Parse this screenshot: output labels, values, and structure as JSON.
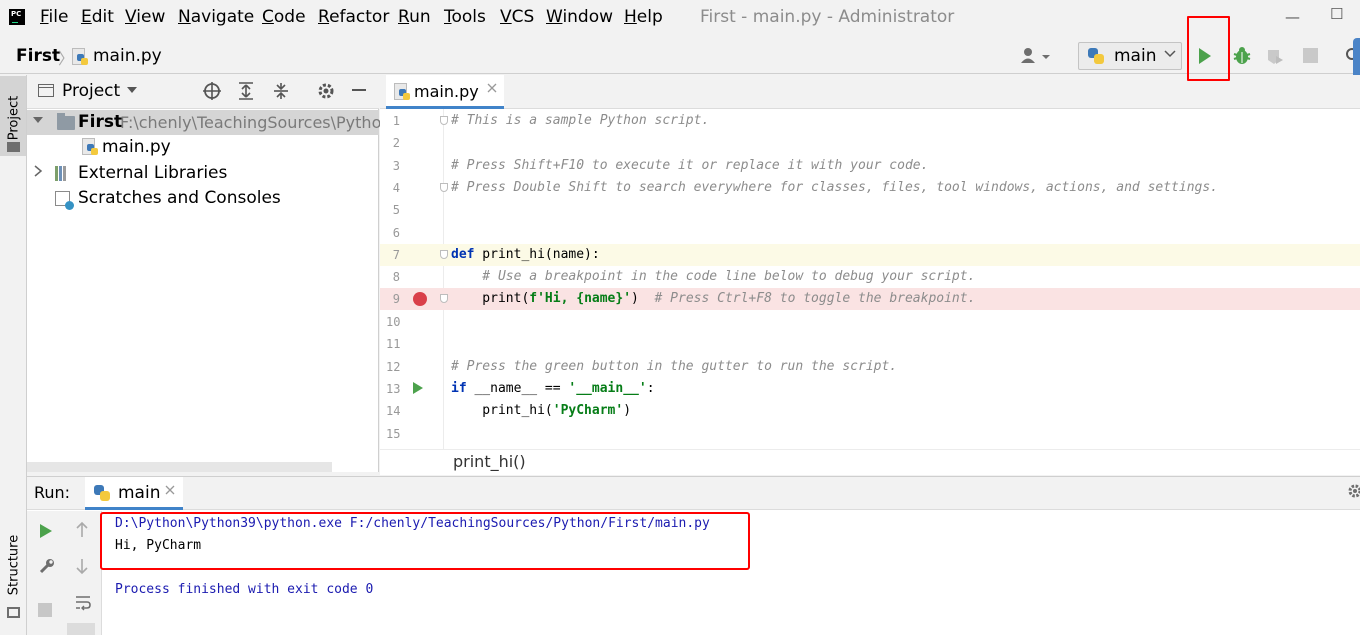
{
  "window": {
    "title": "First - main.py - Administrator",
    "minimize": "—",
    "maximize": "☐"
  },
  "menu": [
    "File",
    "Edit",
    "View",
    "Navigate",
    "Code",
    "Refactor",
    "Run",
    "Tools",
    "VCS",
    "Window",
    "Help"
  ],
  "navbar": {
    "project": "First",
    "separator": "〉",
    "file": "main.py",
    "run_config": "main",
    "user_icon": "user-icon"
  },
  "project_panel": {
    "tab_label": "Project",
    "header_label": "Project",
    "tree": [
      {
        "label": "First",
        "path": "F:\\chenly\\TeachingSources\\Pytho",
        "expanded": true,
        "icon": "folder-icon"
      },
      {
        "label": "main.py",
        "icon": "python-file-icon"
      },
      {
        "label": "External Libraries",
        "icon": "library-icon"
      },
      {
        "label": "Scratches and Consoles",
        "icon": "scratch-icon"
      }
    ]
  },
  "structure_tab": "Structure",
  "editor": {
    "tab_label": "main.py",
    "lines": [
      {
        "n": "1",
        "text": "# This is a sample Python script."
      },
      {
        "n": "2",
        "text": ""
      },
      {
        "n": "3",
        "text": "# Press Shift+F10 to execute it or replace it with your code."
      },
      {
        "n": "4",
        "text": "# Press Double Shift to search everywhere for classes, files, tool windows, actions, and settings."
      },
      {
        "n": "5",
        "text": ""
      },
      {
        "n": "6",
        "text": ""
      },
      {
        "n": "7",
        "kw": "def",
        "text": " print_hi(name):"
      },
      {
        "n": "8",
        "text": "    # Use a breakpoint in the code line below to debug your script."
      },
      {
        "n": "9",
        "code": "    print(",
        "str": "f'Hi, {name}'",
        "code2": ")  ",
        "comment": "# Press Ctrl+F8 to toggle the breakpoint."
      },
      {
        "n": "10",
        "text": ""
      },
      {
        "n": "11",
        "text": ""
      },
      {
        "n": "12",
        "text": "# Press the green button in the gutter to run the script."
      },
      {
        "n": "13",
        "kw": "if",
        "code": " __name__ == ",
        "str": "'__main__'",
        "code2": ":"
      },
      {
        "n": "14",
        "code": "    print_hi(",
        "str": "'PyCharm'",
        "code2": ")"
      },
      {
        "n": "15",
        "text": ""
      }
    ],
    "breadcrumb": "print_hi()"
  },
  "run_panel": {
    "title": "Run:",
    "tab_label": "main",
    "console": {
      "command": "D:\\Python\\Python39\\python.exe F:/chenly/TeachingSources/Python/First/main.py",
      "output": "Hi, PyCharm",
      "exit": "Process finished with exit code 0"
    }
  },
  "colors": {
    "highlight": "#ff0000",
    "run_green": "#4ca24c",
    "breakpoint_red": "#d9404a",
    "accent_blue": "#4083c9"
  }
}
